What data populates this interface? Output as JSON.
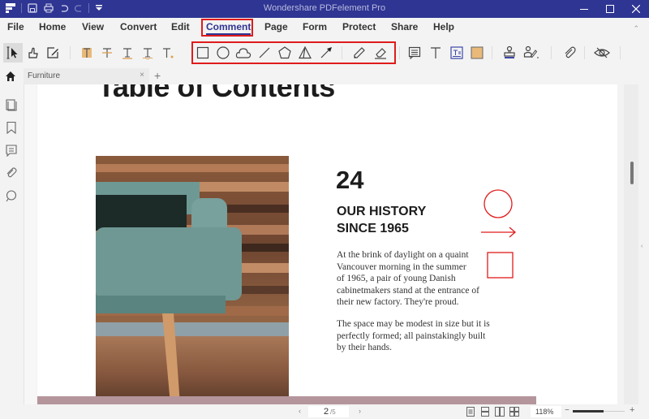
{
  "app": {
    "title": "Wondershare PDFelement Pro",
    "brand_color": "#2f3592",
    "highlight_color": "#e01b1b"
  },
  "quick_access": [
    "app-logo-icon",
    "save-icon",
    "print-icon",
    "undo-icon",
    "redo-icon",
    "customize-dropdown-icon"
  ],
  "window_controls": [
    "minimize-icon",
    "maximize-icon",
    "close-icon"
  ],
  "menu": {
    "items": [
      {
        "label": "File"
      },
      {
        "label": "Home"
      },
      {
        "label": "View"
      },
      {
        "label": "Convert"
      },
      {
        "label": "Edit"
      },
      {
        "label": "Comment",
        "active": true
      },
      {
        "label": "Page"
      },
      {
        "label": "Form"
      },
      {
        "label": "Protect"
      },
      {
        "label": "Share"
      },
      {
        "label": "Help"
      }
    ]
  },
  "toolbar": {
    "tools": [
      "select-tool",
      "hand-tool",
      "edit-annotation-tool",
      "highlight-tool",
      "strikethrough-tool",
      "underline-tool",
      "squiggly-tool",
      "insert-text-tool",
      "rectangle-tool",
      "oval-tool",
      "cloud-tool",
      "line-tool",
      "polygon-tool",
      "polyline-tool",
      "arrow-tool",
      "pencil-tool",
      "eraser-tool",
      "sticky-note-tool",
      "typewriter-tool",
      "text-box-tool",
      "area-highlight-tool",
      "stamp-tool",
      "signature-tool",
      "attachment-tool",
      "hide-annotations-tool"
    ]
  },
  "tabs": [
    {
      "label": "Furniture"
    }
  ],
  "left_panel": [
    "thumbnails-icon",
    "bookmarks-icon",
    "comments-icon",
    "attachments-icon",
    "search-icon"
  ],
  "document": {
    "title": "Table of Contents",
    "number": "24",
    "heading_line1": "OUR HISTORY",
    "heading_line2": "SINCE 1965",
    "paragraph1": [
      "At the brink of daylight on a quaint",
      "Vancouver morning in the summer",
      "of 1965, a pair of young Danish",
      "cabinetmakers stand at the entrance of",
      "their new factory. They're proud."
    ],
    "paragraph2": [
      "The space may be modest in size but it is",
      "perfectly formed; all painstakingly built",
      "by their hands."
    ],
    "annotations": [
      "circle-annotation",
      "arrow-annotation",
      "rectangle-annotation"
    ]
  },
  "status": {
    "current_page": "2",
    "total_pages": "/5",
    "zoom": "118%",
    "zoom_slider_value": 0.6,
    "view_modes": [
      "single-page-icon",
      "continuous-page-icon",
      "two-page-icon",
      "two-page-continuous-icon"
    ]
  }
}
